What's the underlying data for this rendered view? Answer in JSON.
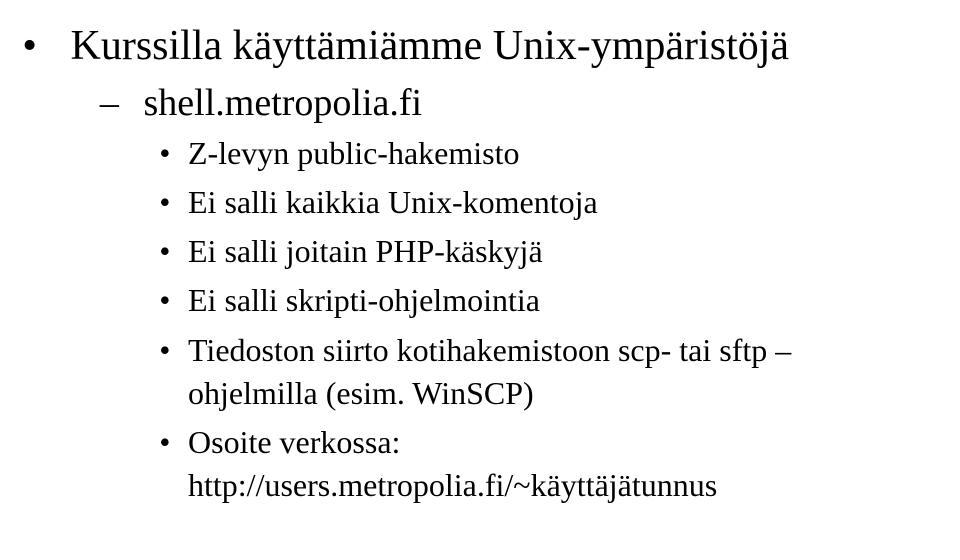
{
  "slide": {
    "title": "Kurssilla käyttämiämme Unix-ympäristöjä",
    "subitem": "shell.metropolia.fi",
    "points": [
      "Z-levyn public-hakemisto",
      "Ei salli kaikkia Unix-komentoja",
      "Ei salli joitain PHP-käskyjä",
      "Ei salli skripti-ohjelmointia",
      "Tiedoston siirto kotihakemistoon scp- tai sftp –ohjelmilla (esim. WinSCP)",
      "Osoite verkossa: http://users.metropolia.fi/~käyttäjätunnus"
    ]
  }
}
